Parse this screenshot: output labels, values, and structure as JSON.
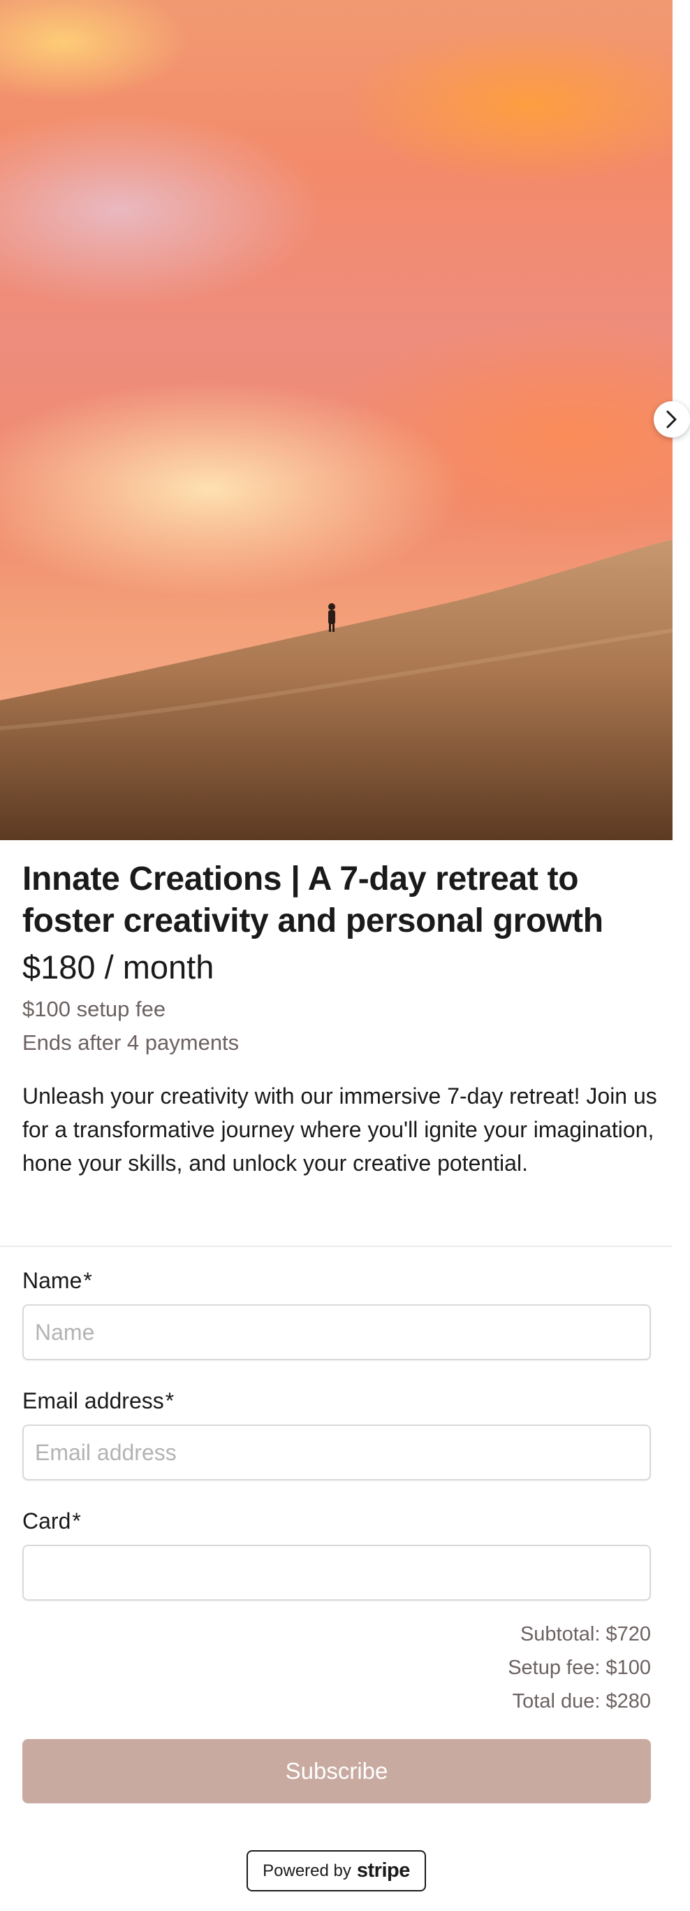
{
  "hero": {
    "image_alt": "Person walking on a desert sand dune under an orange sunset sky",
    "next_icon": "chevron-right-icon"
  },
  "product": {
    "title": "Innate Creations | A 7-day retreat to foster creativity and personal growth",
    "price": "$180 / month",
    "setup_fee": "$100 setup fee",
    "ends_after": "Ends after 4 payments",
    "description": "Unleash your creativity with our immersive 7-day retreat! Join us for a transformative journey where you'll ignite your imagination, hone your skills, and unlock your creative potential."
  },
  "form": {
    "name_label": "Name",
    "name_placeholder": "Name",
    "email_label": "Email address",
    "email_placeholder": "Email address",
    "card_label": "Card",
    "required_mark": "*"
  },
  "totals": {
    "subtotal": "Subtotal: $720",
    "setup_fee": "Setup fee: $100",
    "total_due": "Total due: $280"
  },
  "subscribe_label": "Subscribe",
  "footer": {
    "powered_by": "Powered by",
    "brand": "stripe"
  },
  "colors": {
    "button_bg": "#c8aaa0",
    "muted_text": "#6d6161"
  }
}
